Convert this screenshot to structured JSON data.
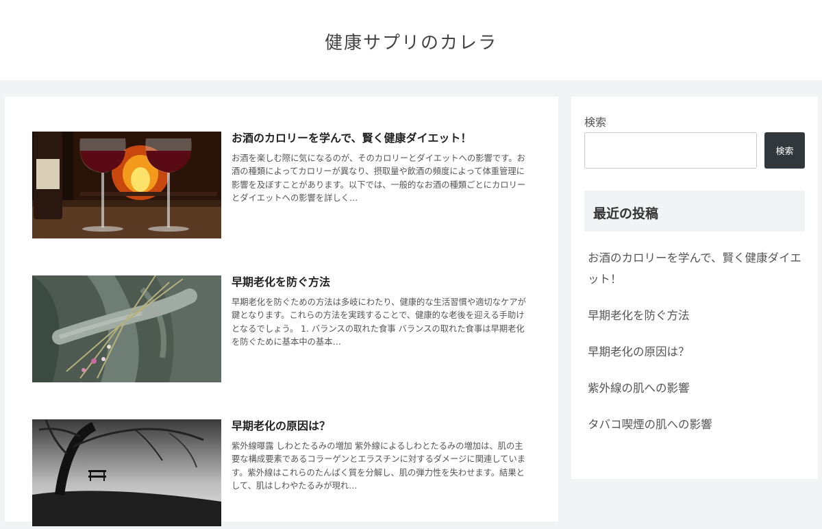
{
  "site": {
    "title": "健康サプリのカレラ"
  },
  "posts": [
    {
      "title": "お酒のカロリーを学んで、賢く健康ダイエット！",
      "excerpt": "お酒を楽しむ際に気になるのが、そのカロリーとダイエットへの影響です。お酒の種類によってカロリーが異なり、摂取量や飲酒の頻度によって体重管理に影響を及ぼすことがあります。以下では、一般的なお酒の種類ごとにカロリーとダイエットへの影響を詳しく…",
      "thumb": "wine-glasses-image"
    },
    {
      "title": "早期老化を防ぐ方法",
      "excerpt": "早期老化を防ぐための方法は多岐にわたり、健康的な生活習慣や適切なケアが鍵となります。これらの方法を実践することで、健康的な老後を迎える手助けとなるでしょう。 1. バランスの取れた食事 バランスの取れた食事は早期老化を防ぐために基本中の基本…",
      "thumb": "statue-flowers-image"
    },
    {
      "title": "早期老化の原因は？",
      "excerpt": "紫外線曝露 しわとたるみの増加 紫外線によるしわとたるみの増加は、肌の主要な構成要素であるコラーゲンとエラスチンに対するダメージに関連しています。紫外線はこれらのたんぱく質を分解し、肌の弾力性を失わせます。結果として、肌はしわやたるみが現れ…",
      "thumb": "tree-bench-image"
    }
  ],
  "sidebar": {
    "search_label": "検索",
    "search_value": "",
    "search_button": "検索",
    "recent_title": "最近の投稿",
    "recent_posts": [
      "お酒のカロリーを学んで、賢く健康ダイエット！",
      "早期老化を防ぐ方法",
      "早期老化の原因は？",
      "紫外線の肌への影響",
      "タバコ喫煙の肌への影響"
    ]
  },
  "colors": {
    "button_bg": "#32373c",
    "page_bg": "#f2f3f5",
    "card_bg": "#ffffff"
  }
}
